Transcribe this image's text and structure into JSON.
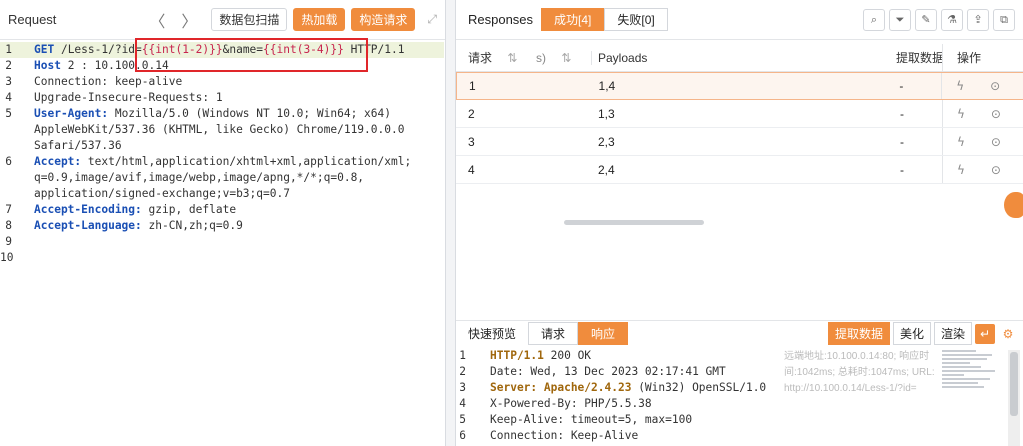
{
  "request": {
    "title": "Request",
    "nav_prev": "〈",
    "nav_next": "〉",
    "btn_scan": "数据包扫描",
    "btn_hot": "热加载",
    "btn_build": "构造请求",
    "expand": "⤢",
    "lines": [
      {
        "n": "1",
        "parts": [
          [
            "kw",
            "GET"
          ],
          [
            "t",
            " /Less-1/?id="
          ],
          [
            "var",
            "{{int(1-2)}}"
          ],
          [
            "t",
            "&name="
          ],
          [
            "var",
            "{{int(3-4)}}"
          ],
          [
            "t",
            " HTTP/1.1"
          ]
        ]
      },
      {
        "n": "2",
        "parts": [
          [
            "kw",
            "Host"
          ],
          [
            "t",
            " 2 : 10.100.0.14"
          ]
        ]
      },
      {
        "n": "3",
        "parts": [
          [
            "t",
            "Connection: keep-alive"
          ]
        ]
      },
      {
        "n": "4",
        "parts": [
          [
            "t",
            "Upgrade-Insecure-Requests: 1"
          ]
        ]
      },
      {
        "n": "5",
        "parts": [
          [
            "kw",
            "User-Agent:"
          ],
          [
            "t",
            " Mozilla/5.0 (Windows NT 10.0; Win64; x64)"
          ]
        ]
      },
      {
        "n": "",
        "parts": [
          [
            "t",
            "AppleWebKit/537.36 (KHTML, like Gecko) Chrome/119.0.0.0"
          ]
        ]
      },
      {
        "n": "",
        "parts": [
          [
            "t",
            "Safari/537.36"
          ]
        ]
      },
      {
        "n": "6",
        "parts": [
          [
            "kw",
            "Accept:"
          ],
          [
            "t",
            " text/html,application/xhtml+xml,application/xml;"
          ]
        ]
      },
      {
        "n": "",
        "parts": [
          [
            "t",
            "q=0.9,image/avif,image/webp,image/apng,*/*;q=0.8,"
          ]
        ]
      },
      {
        "n": "",
        "parts": [
          [
            "t",
            "application/signed-exchange;v=b3;q=0.7"
          ]
        ]
      },
      {
        "n": "7",
        "parts": [
          [
            "kw",
            "Accept-Encoding:"
          ],
          [
            "t",
            " gzip, deflate"
          ]
        ]
      },
      {
        "n": "8",
        "parts": [
          [
            "kw",
            "Accept-Language:"
          ],
          [
            "t",
            " zh-CN,zh;q=0.9"
          ]
        ]
      },
      {
        "n": "9",
        "parts": []
      },
      {
        "n": "10",
        "parts": []
      }
    ]
  },
  "responses": {
    "title": "Responses",
    "tab_success": "成功[4]",
    "tab_fail": "失败[0]",
    "icons": [
      "search-icon",
      "filter-icon",
      "pin-icon",
      "flask-icon",
      "export-icon",
      "copy-icon"
    ],
    "icon_glyphs": [
      "⌕",
      "⏷",
      "✎",
      "⚗",
      "⇪",
      "⧉"
    ],
    "headers": {
      "req": "请求",
      "sort": "⇅",
      "sec": "s)",
      "payloads": "Payloads",
      "extract": "提取数据",
      "ops": "操作"
    },
    "rows": [
      {
        "req": "1",
        "payload": "1,4",
        "extract": "-"
      },
      {
        "req": "2",
        "payload": "1,3",
        "extract": "-"
      },
      {
        "req": "3",
        "payload": "2,3",
        "extract": "-"
      },
      {
        "req": "4",
        "payload": "2,4",
        "extract": "-"
      }
    ],
    "op_glyph_1": "ϟ",
    "op_glyph_2": "⊙"
  },
  "quick": {
    "title": "快速预览",
    "tab_req": "请求",
    "tab_resp": "响应",
    "btn_extract": "提取数据",
    "btn_beautify": "美化",
    "btn_render": "渲染",
    "sq_glyph": "↵",
    "gear_glyph": "⚙",
    "side_info": [
      "远端地址:10.100.0.14:80; 响应时",
      "间:1042ms; 总耗时:1047ms; URL:",
      "http://10.100.0.14/Less-1/?id="
    ],
    "lines": [
      {
        "n": "1",
        "parts": [
          [
            "ok",
            "HTTP/1.1"
          ],
          [
            "t",
            " 200 OK"
          ]
        ]
      },
      {
        "n": "2",
        "parts": [
          [
            "t",
            "Date: Wed, 13 Dec 2023 02:17:41 GMT"
          ]
        ]
      },
      {
        "n": "3",
        "parts": [
          [
            "ok",
            "Server: Apache/2.4.23"
          ],
          [
            "t",
            " (Win32) OpenSSL/1.0"
          ]
        ]
      },
      {
        "n": "4",
        "parts": [
          [
            "t",
            "X-Powered-By: PHP/5.5.38"
          ]
        ]
      },
      {
        "n": "5",
        "parts": [
          [
            "t",
            "Keep-Alive: timeout=5, max=100"
          ]
        ]
      },
      {
        "n": "6",
        "parts": [
          [
            "t",
            "Connection: Keep-Alive"
          ]
        ]
      }
    ]
  }
}
